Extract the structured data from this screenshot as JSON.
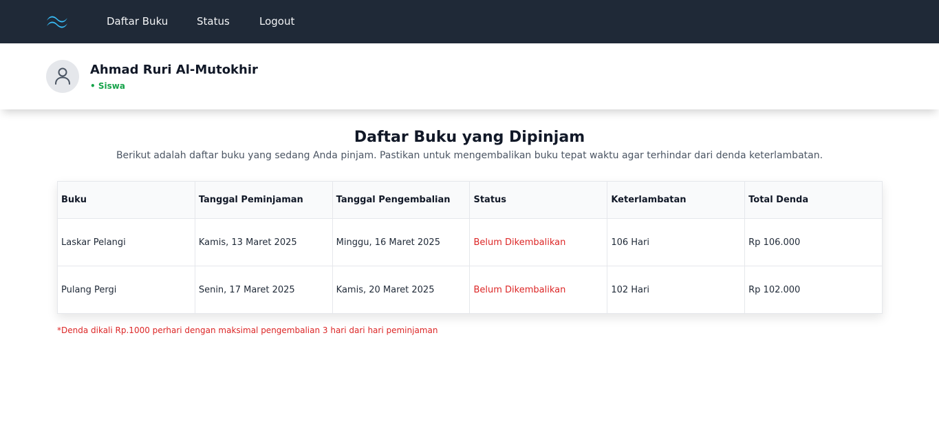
{
  "nav": {
    "logo_icon": "tailwind-logo-icon",
    "links": [
      "Daftar Buku",
      "Status",
      "Logout"
    ]
  },
  "profile": {
    "avatar_icon": "user-icon",
    "name": "Ahmad Ruri Al-Mutokhir",
    "role": "• Siswa"
  },
  "main": {
    "title": "Daftar Buku yang Dipinjam",
    "subtitle": "Berikut adalah daftar buku yang sedang Anda pinjam. Pastikan untuk mengembalikan buku tepat waktu agar terhindar dari denda keterlambatan."
  },
  "table": {
    "headers": [
      "Buku",
      "Tanggal Peminjaman",
      "Tanggal Pengembalian",
      "Status",
      "Keterlambatan",
      "Total Denda"
    ],
    "rows": [
      [
        "Laskar Pelangi",
        "Kamis, 13 Maret 2025",
        "Minggu, 16 Maret 2025",
        "Belum Dikembalikan",
        "106 Hari",
        "Rp 106.000"
      ],
      [
        "Pulang Pergi",
        "Senin, 17 Maret 2025",
        "Kamis, 20 Maret 2025",
        "Belum Dikembalikan",
        "102 Hari",
        "Rp 102.000"
      ]
    ]
  },
  "note": "*Denda dikali Rp.1000 perhari dengan maksimal pengembalian 3 hari dari hari peminjaman",
  "colors": {
    "navbar": "#1f2937",
    "logo": "#38bdf8",
    "role": "#16a34a",
    "status": "#dc2626"
  }
}
